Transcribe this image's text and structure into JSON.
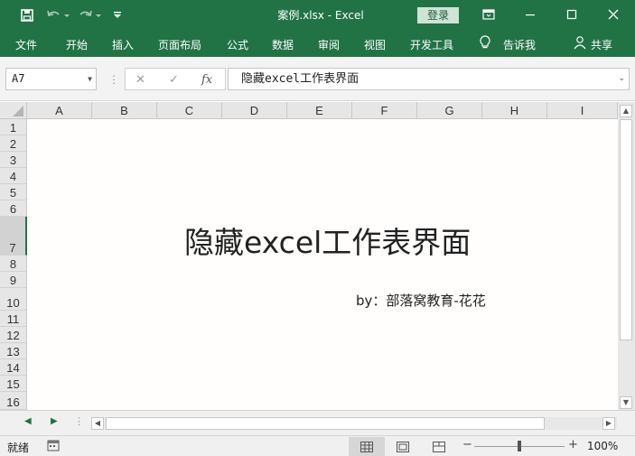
{
  "titlebar": {
    "title": "案例.xlsx  -  Excel",
    "login": "登录",
    "colors": {
      "brand": "#217346"
    }
  },
  "ribbon": {
    "tabs": [
      "文件",
      "开始",
      "插入",
      "页面布局",
      "公式",
      "数据",
      "审阅",
      "视图",
      "开发工具"
    ],
    "tell_me": "告诉我",
    "share": "共享"
  },
  "formula_bar": {
    "name_box": "A7",
    "fx_label": "fx",
    "content": "隐藏excel工作表界面"
  },
  "grid": {
    "columns": [
      "A",
      "B",
      "C",
      "D",
      "E",
      "F",
      "G",
      "H",
      "I"
    ],
    "rows": [
      "1",
      "2",
      "3",
      "4",
      "5",
      "6",
      "7",
      "8",
      "9",
      "10",
      "11",
      "12",
      "13",
      "14",
      "15",
      "16"
    ],
    "selected_row": "7",
    "title_text": "隐藏excel工作表界面",
    "byline": "by：部落窝教育-花花"
  },
  "status": {
    "ready": "就绪",
    "zoom_minus": "−",
    "zoom_plus": "+",
    "zoom": "100%",
    "zoom_level": 1.0
  }
}
